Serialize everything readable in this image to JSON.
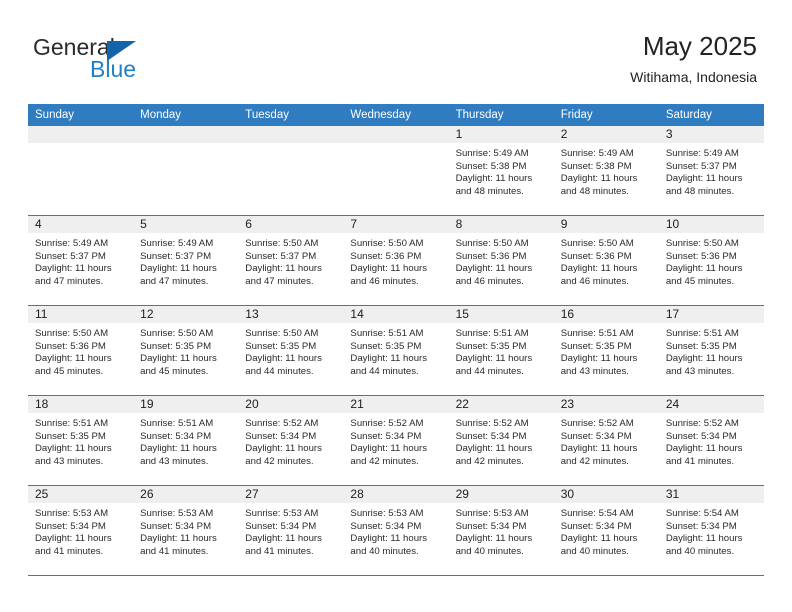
{
  "brand": {
    "name_part1": "General",
    "name_part2": "Blue",
    "color_blue": "#2081c7",
    "color_triangle": "#1463ad"
  },
  "header": {
    "title": "May 2025",
    "subtitle": "Witihama, Indonesia"
  },
  "theme": {
    "header_row_bg": "#2f7cc0",
    "date_band_bg": "#efefef",
    "row_divider": "#2f7cc0"
  },
  "weekdays": [
    "Sunday",
    "Monday",
    "Tuesday",
    "Wednesday",
    "Thursday",
    "Friday",
    "Saturday"
  ],
  "weeks": [
    [
      {
        "date": "",
        "empty": true,
        "sunrise": "",
        "sunset": "",
        "daylight_line1": "",
        "daylight_line2": ""
      },
      {
        "date": "",
        "empty": true,
        "sunrise": "",
        "sunset": "",
        "daylight_line1": "",
        "daylight_line2": ""
      },
      {
        "date": "",
        "empty": true,
        "sunrise": "",
        "sunset": "",
        "daylight_line1": "",
        "daylight_line2": ""
      },
      {
        "date": "",
        "empty": true,
        "sunrise": "",
        "sunset": "",
        "daylight_line1": "",
        "daylight_line2": ""
      },
      {
        "date": "1",
        "empty": false,
        "sunrise": "Sunrise: 5:49 AM",
        "sunset": "Sunset: 5:38 PM",
        "daylight_line1": "Daylight: 11 hours",
        "daylight_line2": "and 48 minutes."
      },
      {
        "date": "2",
        "empty": false,
        "sunrise": "Sunrise: 5:49 AM",
        "sunset": "Sunset: 5:38 PM",
        "daylight_line1": "Daylight: 11 hours",
        "daylight_line2": "and 48 minutes."
      },
      {
        "date": "3",
        "empty": false,
        "sunrise": "Sunrise: 5:49 AM",
        "sunset": "Sunset: 5:37 PM",
        "daylight_line1": "Daylight: 11 hours",
        "daylight_line2": "and 48 minutes."
      }
    ],
    [
      {
        "date": "4",
        "empty": false,
        "sunrise": "Sunrise: 5:49 AM",
        "sunset": "Sunset: 5:37 PM",
        "daylight_line1": "Daylight: 11 hours",
        "daylight_line2": "and 47 minutes."
      },
      {
        "date": "5",
        "empty": false,
        "sunrise": "Sunrise: 5:49 AM",
        "sunset": "Sunset: 5:37 PM",
        "daylight_line1": "Daylight: 11 hours",
        "daylight_line2": "and 47 minutes."
      },
      {
        "date": "6",
        "empty": false,
        "sunrise": "Sunrise: 5:50 AM",
        "sunset": "Sunset: 5:37 PM",
        "daylight_line1": "Daylight: 11 hours",
        "daylight_line2": "and 47 minutes."
      },
      {
        "date": "7",
        "empty": false,
        "sunrise": "Sunrise: 5:50 AM",
        "sunset": "Sunset: 5:36 PM",
        "daylight_line1": "Daylight: 11 hours",
        "daylight_line2": "and 46 minutes."
      },
      {
        "date": "8",
        "empty": false,
        "sunrise": "Sunrise: 5:50 AM",
        "sunset": "Sunset: 5:36 PM",
        "daylight_line1": "Daylight: 11 hours",
        "daylight_line2": "and 46 minutes."
      },
      {
        "date": "9",
        "empty": false,
        "sunrise": "Sunrise: 5:50 AM",
        "sunset": "Sunset: 5:36 PM",
        "daylight_line1": "Daylight: 11 hours",
        "daylight_line2": "and 46 minutes."
      },
      {
        "date": "10",
        "empty": false,
        "sunrise": "Sunrise: 5:50 AM",
        "sunset": "Sunset: 5:36 PM",
        "daylight_line1": "Daylight: 11 hours",
        "daylight_line2": "and 45 minutes."
      }
    ],
    [
      {
        "date": "11",
        "empty": false,
        "sunrise": "Sunrise: 5:50 AM",
        "sunset": "Sunset: 5:36 PM",
        "daylight_line1": "Daylight: 11 hours",
        "daylight_line2": "and 45 minutes."
      },
      {
        "date": "12",
        "empty": false,
        "sunrise": "Sunrise: 5:50 AM",
        "sunset": "Sunset: 5:35 PM",
        "daylight_line1": "Daylight: 11 hours",
        "daylight_line2": "and 45 minutes."
      },
      {
        "date": "13",
        "empty": false,
        "sunrise": "Sunrise: 5:50 AM",
        "sunset": "Sunset: 5:35 PM",
        "daylight_line1": "Daylight: 11 hours",
        "daylight_line2": "and 44 minutes."
      },
      {
        "date": "14",
        "empty": false,
        "sunrise": "Sunrise: 5:51 AM",
        "sunset": "Sunset: 5:35 PM",
        "daylight_line1": "Daylight: 11 hours",
        "daylight_line2": "and 44 minutes."
      },
      {
        "date": "15",
        "empty": false,
        "sunrise": "Sunrise: 5:51 AM",
        "sunset": "Sunset: 5:35 PM",
        "daylight_line1": "Daylight: 11 hours",
        "daylight_line2": "and 44 minutes."
      },
      {
        "date": "16",
        "empty": false,
        "sunrise": "Sunrise: 5:51 AM",
        "sunset": "Sunset: 5:35 PM",
        "daylight_line1": "Daylight: 11 hours",
        "daylight_line2": "and 43 minutes."
      },
      {
        "date": "17",
        "empty": false,
        "sunrise": "Sunrise: 5:51 AM",
        "sunset": "Sunset: 5:35 PM",
        "daylight_line1": "Daylight: 11 hours",
        "daylight_line2": "and 43 minutes."
      }
    ],
    [
      {
        "date": "18",
        "empty": false,
        "sunrise": "Sunrise: 5:51 AM",
        "sunset": "Sunset: 5:35 PM",
        "daylight_line1": "Daylight: 11 hours",
        "daylight_line2": "and 43 minutes."
      },
      {
        "date": "19",
        "empty": false,
        "sunrise": "Sunrise: 5:51 AM",
        "sunset": "Sunset: 5:34 PM",
        "daylight_line1": "Daylight: 11 hours",
        "daylight_line2": "and 43 minutes."
      },
      {
        "date": "20",
        "empty": false,
        "sunrise": "Sunrise: 5:52 AM",
        "sunset": "Sunset: 5:34 PM",
        "daylight_line1": "Daylight: 11 hours",
        "daylight_line2": "and 42 minutes."
      },
      {
        "date": "21",
        "empty": false,
        "sunrise": "Sunrise: 5:52 AM",
        "sunset": "Sunset: 5:34 PM",
        "daylight_line1": "Daylight: 11 hours",
        "daylight_line2": "and 42 minutes."
      },
      {
        "date": "22",
        "empty": false,
        "sunrise": "Sunrise: 5:52 AM",
        "sunset": "Sunset: 5:34 PM",
        "daylight_line1": "Daylight: 11 hours",
        "daylight_line2": "and 42 minutes."
      },
      {
        "date": "23",
        "empty": false,
        "sunrise": "Sunrise: 5:52 AM",
        "sunset": "Sunset: 5:34 PM",
        "daylight_line1": "Daylight: 11 hours",
        "daylight_line2": "and 42 minutes."
      },
      {
        "date": "24",
        "empty": false,
        "sunrise": "Sunrise: 5:52 AM",
        "sunset": "Sunset: 5:34 PM",
        "daylight_line1": "Daylight: 11 hours",
        "daylight_line2": "and 41 minutes."
      }
    ],
    [
      {
        "date": "25",
        "empty": false,
        "sunrise": "Sunrise: 5:53 AM",
        "sunset": "Sunset: 5:34 PM",
        "daylight_line1": "Daylight: 11 hours",
        "daylight_line2": "and 41 minutes."
      },
      {
        "date": "26",
        "empty": false,
        "sunrise": "Sunrise: 5:53 AM",
        "sunset": "Sunset: 5:34 PM",
        "daylight_line1": "Daylight: 11 hours",
        "daylight_line2": "and 41 minutes."
      },
      {
        "date": "27",
        "empty": false,
        "sunrise": "Sunrise: 5:53 AM",
        "sunset": "Sunset: 5:34 PM",
        "daylight_line1": "Daylight: 11 hours",
        "daylight_line2": "and 41 minutes."
      },
      {
        "date": "28",
        "empty": false,
        "sunrise": "Sunrise: 5:53 AM",
        "sunset": "Sunset: 5:34 PM",
        "daylight_line1": "Daylight: 11 hours",
        "daylight_line2": "and 40 minutes."
      },
      {
        "date": "29",
        "empty": false,
        "sunrise": "Sunrise: 5:53 AM",
        "sunset": "Sunset: 5:34 PM",
        "daylight_line1": "Daylight: 11 hours",
        "daylight_line2": "and 40 minutes."
      },
      {
        "date": "30",
        "empty": false,
        "sunrise": "Sunrise: 5:54 AM",
        "sunset": "Sunset: 5:34 PM",
        "daylight_line1": "Daylight: 11 hours",
        "daylight_line2": "and 40 minutes."
      },
      {
        "date": "31",
        "empty": false,
        "sunrise": "Sunrise: 5:54 AM",
        "sunset": "Sunset: 5:34 PM",
        "daylight_line1": "Daylight: 11 hours",
        "daylight_line2": "and 40 minutes."
      }
    ]
  ]
}
